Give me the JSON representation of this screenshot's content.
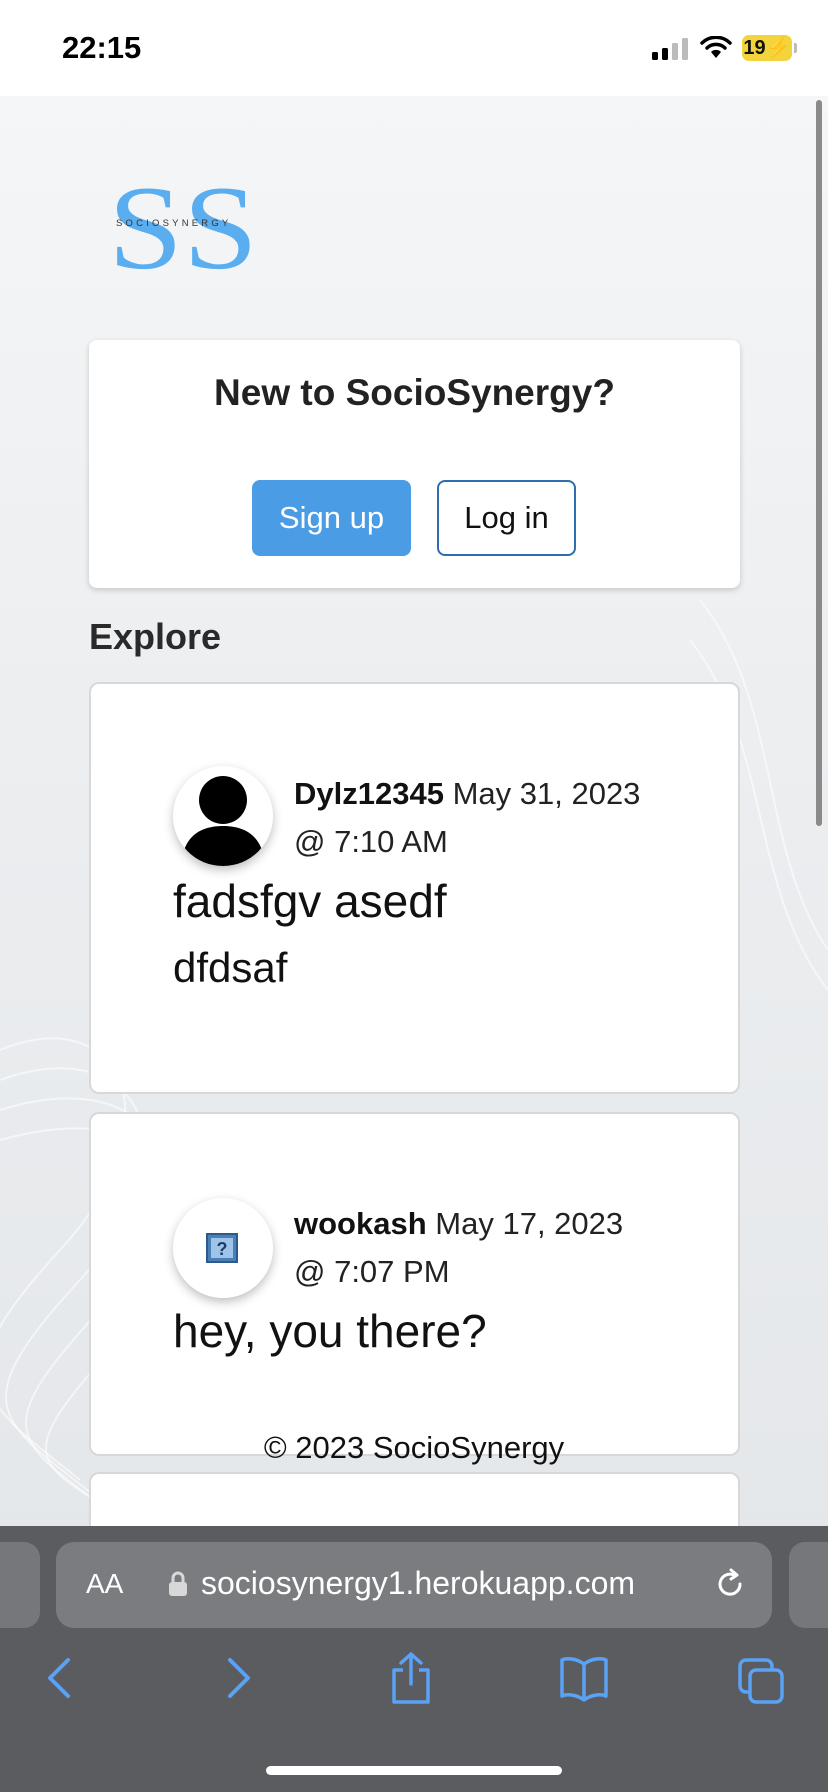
{
  "status_bar": {
    "time": "22:15",
    "battery": "19"
  },
  "logo": {
    "text": "SOCIOSYNERGY"
  },
  "intro": {
    "title": "New to SocioSynergy?",
    "signup_label": "Sign up",
    "login_label": "Log in"
  },
  "explore": {
    "heading": "Explore"
  },
  "posts": [
    {
      "username": "Dylz12345",
      "date": "May 31, 2023",
      "time": "@ 7:10 AM",
      "text": "fadsfgv asedf",
      "subtext": "dfdsaf"
    },
    {
      "username": "wookash",
      "date": "May 17, 2023",
      "time": "@ 7:07 PM",
      "text": "hey, you there?"
    }
  ],
  "footer": {
    "text": "© 2023 SocioSynergy"
  },
  "browser": {
    "aa_label": "AA",
    "url": "sociosynergy1.herokuapp.com"
  },
  "colors": {
    "accent": "#4a9de4",
    "login_border": "#2f6db0",
    "safari_blue": "#5aa2f5"
  }
}
